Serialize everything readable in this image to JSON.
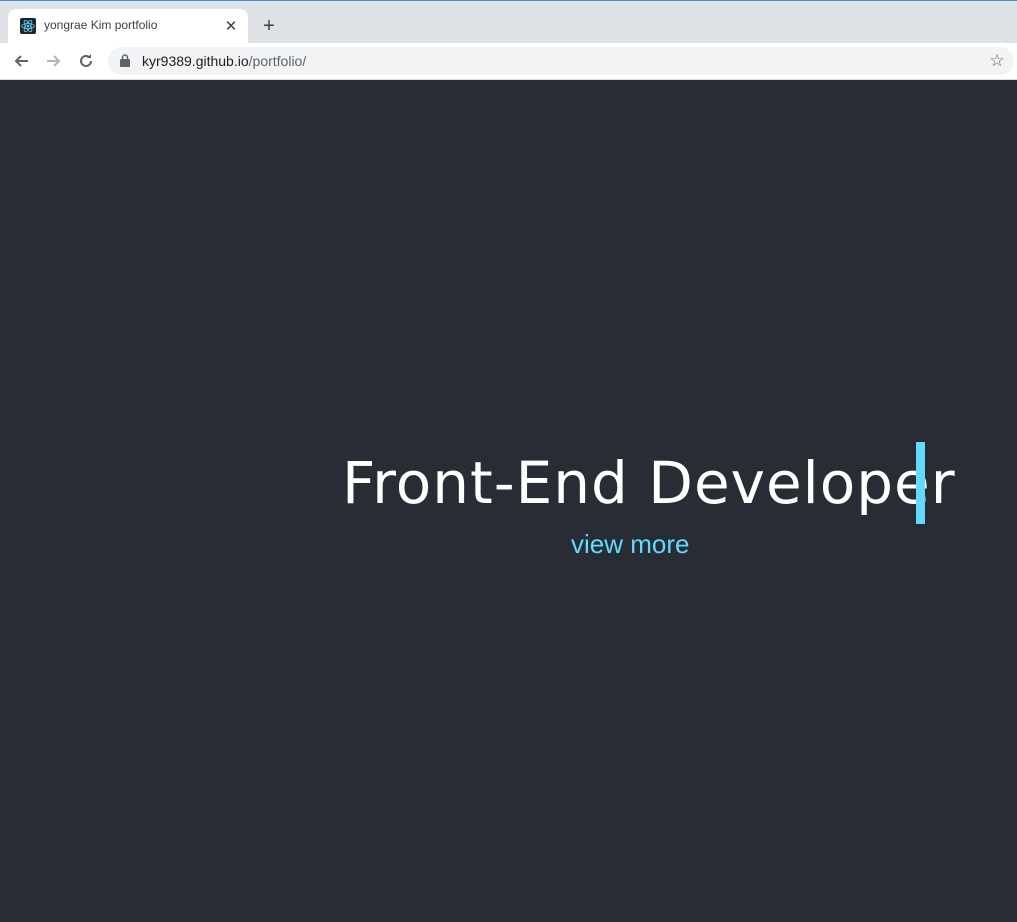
{
  "browser": {
    "tab": {
      "title": "yongrae Kim portfolio",
      "favicon": "react-logo-icon"
    },
    "new_tab_symbol": "+",
    "close_symbol": "✕",
    "url": {
      "host": "kyr9389.github.io",
      "path": "/portfolio/"
    },
    "icons": {
      "back": "back-arrow-icon",
      "forward": "forward-arrow-icon",
      "reload": "reload-icon",
      "lock": "lock-icon",
      "bookmark": "star-icon"
    },
    "star_symbol": "☆"
  },
  "page": {
    "headline": "Front-End Developer",
    "link_label": "view more",
    "colors": {
      "background": "#282c34",
      "accent": "#61dafb",
      "text": "#ffffff"
    }
  }
}
